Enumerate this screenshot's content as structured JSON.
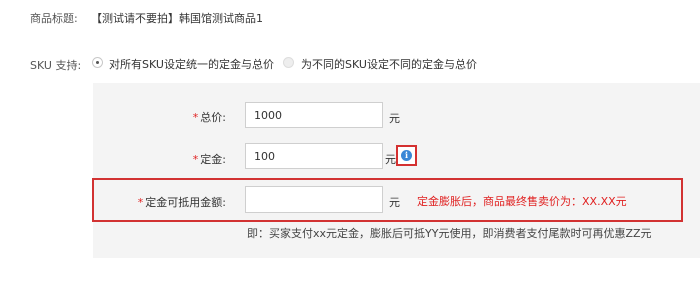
{
  "product": {
    "title_label": "商品标题:",
    "title_value": "【测试请不要拍】韩国馆测试商品1"
  },
  "sku": {
    "label": "SKU 支持:",
    "options": [
      {
        "label": "对所有SKU设定统一的定金与总价",
        "selected": true
      },
      {
        "label": "为不同的SKU设定不同的定金与总价",
        "selected": false
      }
    ]
  },
  "form": {
    "total_price": {
      "required_mark": "*",
      "label": "总价:",
      "value": "1000",
      "unit": "元"
    },
    "deposit": {
      "required_mark": "*",
      "label": "定金:",
      "value": "100",
      "unit": "元",
      "info_icon": "info-icon"
    },
    "deductible": {
      "required_mark": "*",
      "label": "定金可抵用金额:",
      "value": "",
      "unit": "元",
      "note": "定金膨胀后，商品最终售卖价为：XX.XX元"
    },
    "hint": "即：买家支付xx元定金，膨胀后可抵YY元使用，即消费者支付尾款时可再优惠ZZ元"
  },
  "colors": {
    "required": "#e02020",
    "highlight_frame": "#d23232",
    "info_icon": "#3a87d6",
    "panel_bg": "#f4f4f4"
  }
}
